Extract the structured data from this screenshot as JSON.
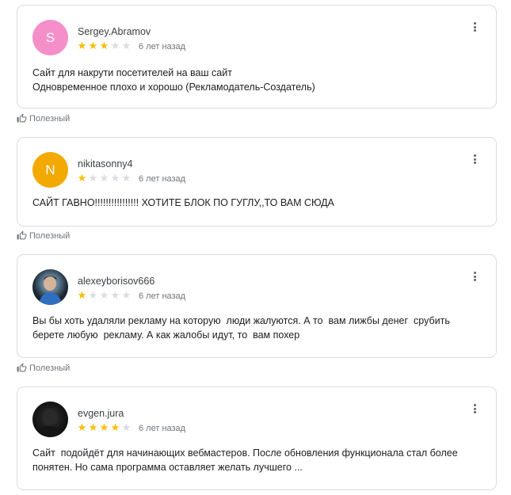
{
  "colors": {
    "star": "#fbbc04",
    "star_empty": "#dadce0",
    "border": "#dadce0",
    "muted": "#70757a"
  },
  "reviews": [
    {
      "author": "Sergey.Abramov",
      "avatar_letter": "S",
      "avatar_color": "#f48fc9",
      "rating": 3,
      "date": "6 лет назад",
      "lines": [
        "Сайт для накрути посетителей на ваш сайт",
        "Одновременное плохо и хорошо (Рекламодатель-Создатель)"
      ],
      "helpful_label": "Полезный"
    },
    {
      "author": "nikitasonny4",
      "avatar_letter": "N",
      "avatar_color": "#f2a900",
      "rating": 1,
      "date": "6 лет назад",
      "lines": [
        "САЙТ ГАВНО!!!!!!!!!!!!!!!! ХОТИТЕ БЛОК ПО ГУГЛУ,,ТО ВАМ СЮДА"
      ],
      "helpful_label": "Полезный"
    },
    {
      "author": "alexeyborisov666",
      "avatar_letter": "",
      "avatar_color": "",
      "rating": 1,
      "date": "6 лет назад",
      "lines": [
        "Вы бы хоть удаляли рекламу на которую  люди жалуются. А то  вам лижбы денег  срубить",
        "берете любую  рекламу. А как жалобы идут, то  вам похер"
      ],
      "helpful_label": "Полезный"
    },
    {
      "author": "evgen.jura",
      "avatar_letter": "",
      "avatar_color": "",
      "rating": 4,
      "date": "6 лет назад",
      "lines": [
        "Сайт  подойдёт для начинающих вебмастеров. После обновления функционала стал более",
        "понятен. Но сама программа оставляет желать лучшего ..."
      ],
      "helpful_label": ""
    }
  ]
}
